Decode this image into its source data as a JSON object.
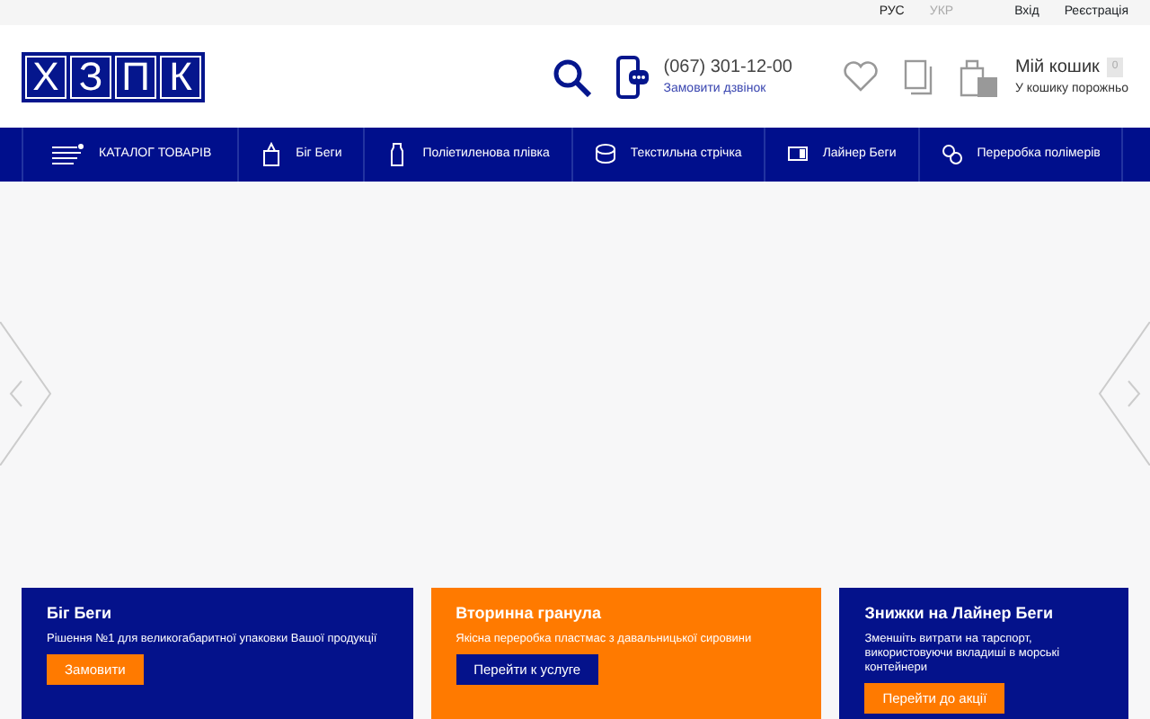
{
  "top_bar": {
    "languages": [
      {
        "label": "РУС",
        "selected": true
      },
      {
        "label": "УКР",
        "selected": false
      }
    ],
    "links": [
      "Вхід",
      "Реєстрація"
    ]
  },
  "header": {
    "logo_letters": [
      "Х",
      "З",
      "П",
      "К"
    ],
    "phone": "(067) 301-12-00",
    "callback_link": "Замовити дзвінок",
    "cart": {
      "title": "Мій кошик",
      "count": "0",
      "status": "У кошику порожньо"
    }
  },
  "nav": [
    {
      "kind": "catalog",
      "label": "КАТАЛОГ ТОВАРІВ"
    },
    {
      "kind": "bag",
      "label": "Біг Беги"
    },
    {
      "kind": "bottle",
      "label": "Поліетиленова плівка"
    },
    {
      "kind": "spool",
      "label": "Текстильна стрічка"
    },
    {
      "kind": "liner",
      "label": "Лайнер Беги"
    },
    {
      "kind": "recycle",
      "label": "Переробка полімерів"
    }
  ],
  "promos": [
    {
      "kind": "blue",
      "title": "Біг Беги",
      "text": "Рішення №1 для великогабаритної упаковки Вашої продукції",
      "button": "Замовити"
    },
    {
      "kind": "orange",
      "title": "Вторинна гранула",
      "text": "Якісна переробка пластмас з давальницької сировини",
      "button": "Перейти к услуге"
    },
    {
      "kind": "blue",
      "title": "Знижки на Лайнер Беги",
      "text": "Зменшіть витрати на тарспорт, використовуючи вкладиші в морські контейнери",
      "button": "Перейти до акції"
    }
  ]
}
